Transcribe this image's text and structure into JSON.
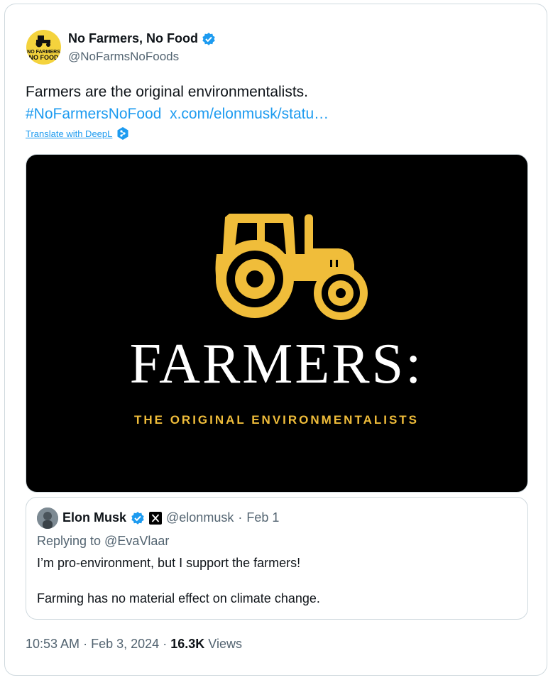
{
  "author": {
    "display_name": "No Farmers, No Food",
    "handle": "@NoFarmsNoFoods",
    "avatar_text_line1": "NO FARMERS",
    "avatar_text_line2": "NO FOOD",
    "verified": true
  },
  "tweet": {
    "text": "Farmers are the original environmentalists.",
    "hashtag": "#NoFarmersNoFood",
    "link": "x.com/elonmusk/statu…",
    "translate_label": "Translate with DeepL"
  },
  "media": {
    "headline": "FARMERS:",
    "subheadline": "THE ORIGINAL ENVIRONMENTALISTS",
    "icon": "tractor-icon"
  },
  "quoted_tweet": {
    "display_name": "Elon Musk",
    "handle": "@elonmusk",
    "date": "Feb 1",
    "separator": "·",
    "replying_to": "Replying to @EvaVlaar",
    "text_line1": "I’m pro-environment, but I support the farmers!",
    "text_line2": "Farming has no material effect on climate change."
  },
  "footer": {
    "time": "10:53 AM",
    "date": "Feb 3, 2024",
    "views_count": "16.3K",
    "views_label": "Views",
    "separator": "·"
  },
  "colors": {
    "link": "#1d9bf0",
    "secondary_text": "#536471",
    "brand_yellow": "#f0bd3a",
    "verified_blue": "#1d9bf0"
  }
}
